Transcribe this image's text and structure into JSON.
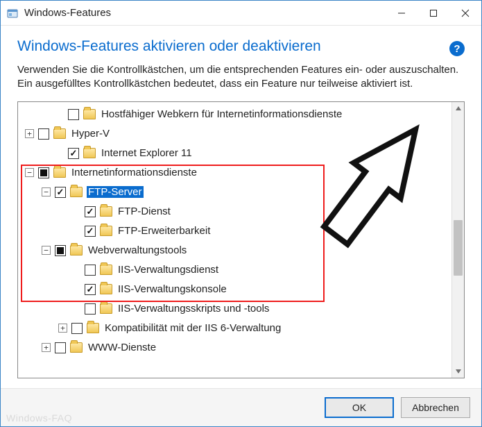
{
  "window": {
    "title": "Windows-Features",
    "minimize_tip": "Minimieren",
    "maximize_tip": "Maximieren",
    "close_tip": "Schließen"
  },
  "heading": "Windows-Features aktivieren oder deaktivieren",
  "help_label": "?",
  "description": "Verwenden Sie die Kontrollkästchen, um die entsprechenden Features ein- oder auszuschalten. Ein ausgefülltes Kontrollkästchen bedeutet, dass ein Feature nur teilweise aktiviert ist.",
  "tree": [
    {
      "level": 1,
      "expand": "none",
      "check": "unchecked",
      "label": "Hostfähiger Webkern für Internetinformationsdienste",
      "selected": false
    },
    {
      "level": 0,
      "expand": "plus",
      "check": "unchecked",
      "label": "Hyper-V",
      "selected": false
    },
    {
      "level": 1,
      "expand": "none",
      "check": "checked",
      "label": "Internet Explorer 11",
      "selected": false
    },
    {
      "level": 0,
      "expand": "minus",
      "check": "partial",
      "label": "Internetinformationsdienste",
      "selected": false
    },
    {
      "level": 1,
      "expand": "minus",
      "check": "checked",
      "label": "FTP-Server",
      "selected": true
    },
    {
      "level": 2,
      "expand": "none",
      "check": "checked",
      "label": "FTP-Dienst",
      "selected": false
    },
    {
      "level": 2,
      "expand": "none",
      "check": "checked",
      "label": "FTP-Erweiterbarkeit",
      "selected": false
    },
    {
      "level": 1,
      "expand": "minus",
      "check": "partial",
      "label": "Webverwaltungstools",
      "selected": false
    },
    {
      "level": 2,
      "expand": "none",
      "check": "unchecked",
      "label": "IIS-Verwaltungsdienst",
      "selected": false
    },
    {
      "level": 2,
      "expand": "none",
      "check": "checked",
      "label": "IIS-Verwaltungskonsole",
      "selected": false
    },
    {
      "level": 2,
      "expand": "none",
      "check": "unchecked",
      "label": "IIS-Verwaltungsskripts und -tools",
      "selected": false
    },
    {
      "level": 2,
      "expand": "plus",
      "check": "unchecked",
      "label": "Kompatibilität mit der IIS 6-Verwaltung",
      "selected": false
    },
    {
      "level": 1,
      "expand": "plus",
      "check": "unchecked",
      "label": "WWW-Dienste",
      "selected": false
    }
  ],
  "buttons": {
    "ok": "OK",
    "cancel": "Abbrechen"
  },
  "watermark": "Windows-FAQ"
}
